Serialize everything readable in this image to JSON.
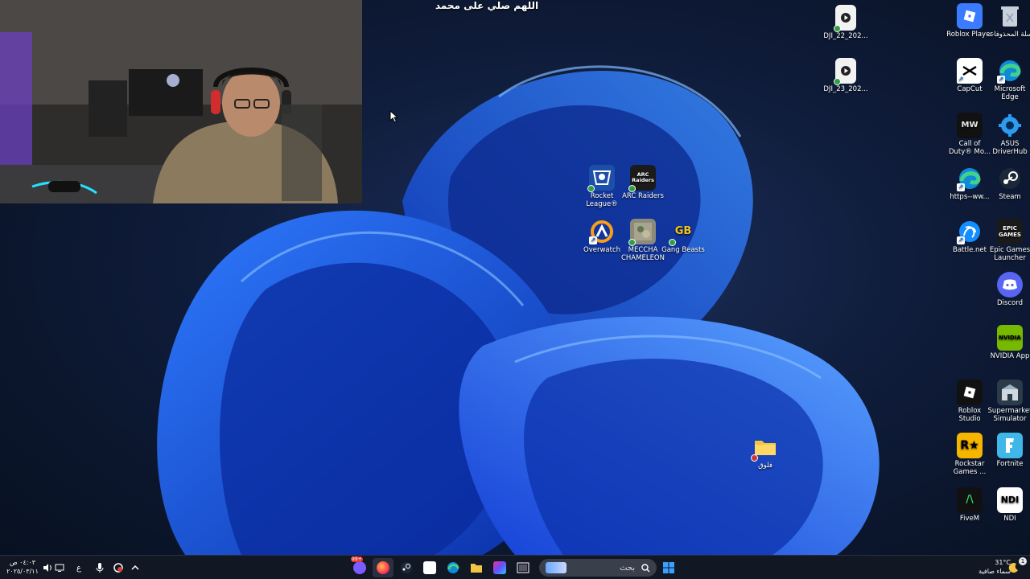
{
  "overlay_text": "اللهم صلي على محمد",
  "desktop_icons": {
    "recycle_bin": "سلة المحذوفات",
    "roblox_player": "Roblox Player",
    "capcut": "CapCut",
    "microsoft_edge": "Microsoft Edge",
    "call_of_duty": "Call of Duty® Mo...",
    "asus_driverhub": "ASUS DriverHub",
    "https_www": "https--ww...",
    "steam": "Steam",
    "battle_net": "Battle.net",
    "epic_games": "Epic Games Launcher",
    "discord": "Discord",
    "nvidia_app": "NVIDIA App",
    "roblox_studio": "Roblox Studio",
    "supermarket_simulator": "Supermarket Simulator",
    "rockstar_games": "Rockstar Games ...",
    "fortnite": "Fortnite",
    "fivem": "FiveM",
    "ndi": "NDI",
    "dji_22": "DJI_22_202...",
    "dji_23": "DJI_23_202...",
    "rocket_league": "Rocket League®",
    "arc_raiders": "ARC Raiders",
    "overwatch": "Overwatch",
    "meccha_chameleon": "MECCHA CHAMELEON",
    "gang_beasts": "Gang Beasts",
    "folder_vlog": "فلوق"
  },
  "icon_glyphs": {
    "arc_raiders": "ARC Raiders",
    "epic_games": "EPIC GAMES",
    "nvidia_app": "NVIDIA",
    "ndi": "NDI",
    "rockstar_games": "R★",
    "fivem": "/\\",
    "call_of_duty": "MW",
    "gang_beasts": "GB"
  },
  "taskbar": {
    "search_placeholder": "بحث",
    "language": "ع",
    "clock_time": "٠٤:٠٣ ص",
    "clock_date": "٢٠٢٥/٠٣/١١",
    "temperature": "31°C",
    "weather_desc": "سماء صافية",
    "notification_count": "1",
    "chat_badge": "99+"
  },
  "colors": {
    "accent": "#1a73e8",
    "taskbar_bg": "#141824",
    "wallpaper_bloom": "#1f5be8"
  }
}
